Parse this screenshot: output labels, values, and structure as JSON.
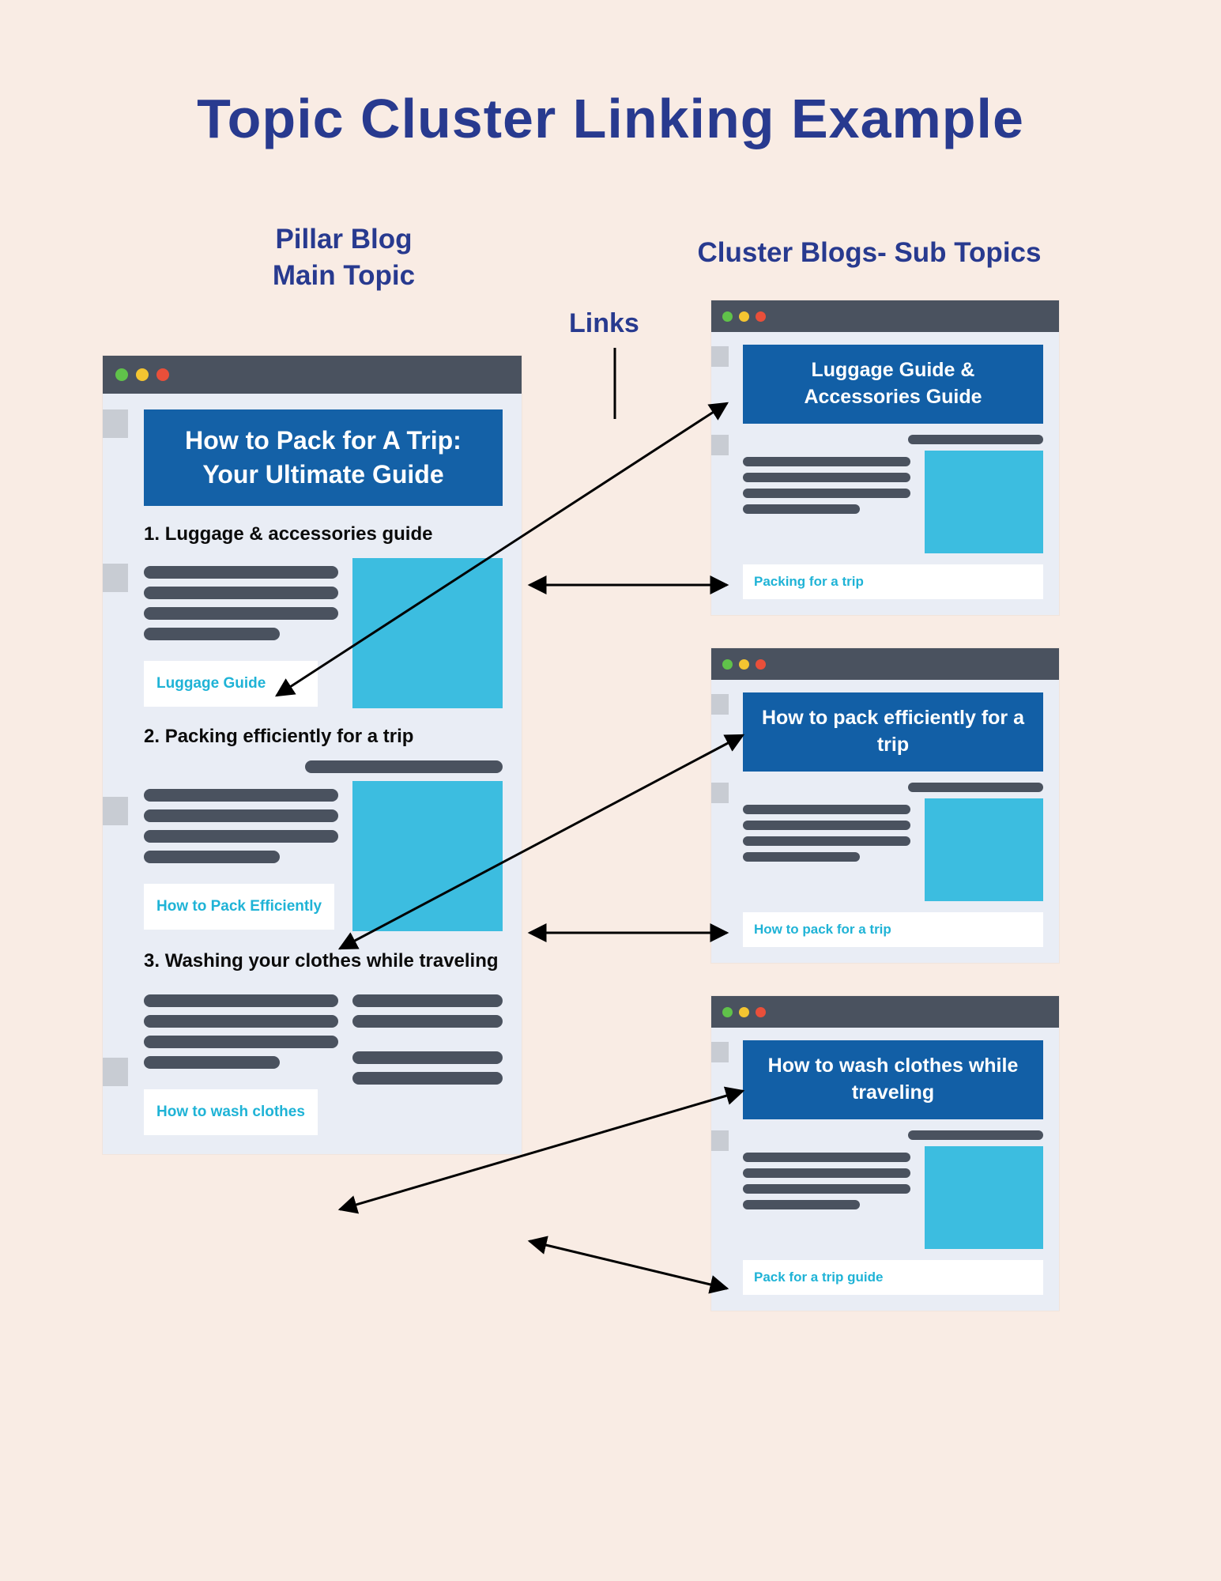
{
  "title": "Topic Cluster Linking Example",
  "labels": {
    "pillar": "Pillar Blog\nMain Topic",
    "cluster": "Cluster Blogs- Sub Topics",
    "links": "Links"
  },
  "pillar": {
    "heading": "How to Pack for A Trip: Your Ultimate Guide",
    "sections": [
      {
        "num": "1.",
        "heading": "Luggage & accessories guide",
        "link_text": "Luggage Guide"
      },
      {
        "num": "2.",
        "heading": "Packing efficiently for a trip",
        "link_text": "How to Pack Efficiently"
      },
      {
        "num": "3.",
        "heading": "Washing your clothes while traveling",
        "link_text": "How to wash clothes"
      }
    ]
  },
  "clusters": [
    {
      "heading": "Luggage Guide & Accessories Guide",
      "back_link": "Packing for a trip"
    },
    {
      "heading": "How to pack efficiently for a trip",
      "back_link": "How to pack for a trip"
    },
    {
      "heading": "How to wash clothes while traveling",
      "back_link": "Pack for a trip guide"
    }
  ]
}
